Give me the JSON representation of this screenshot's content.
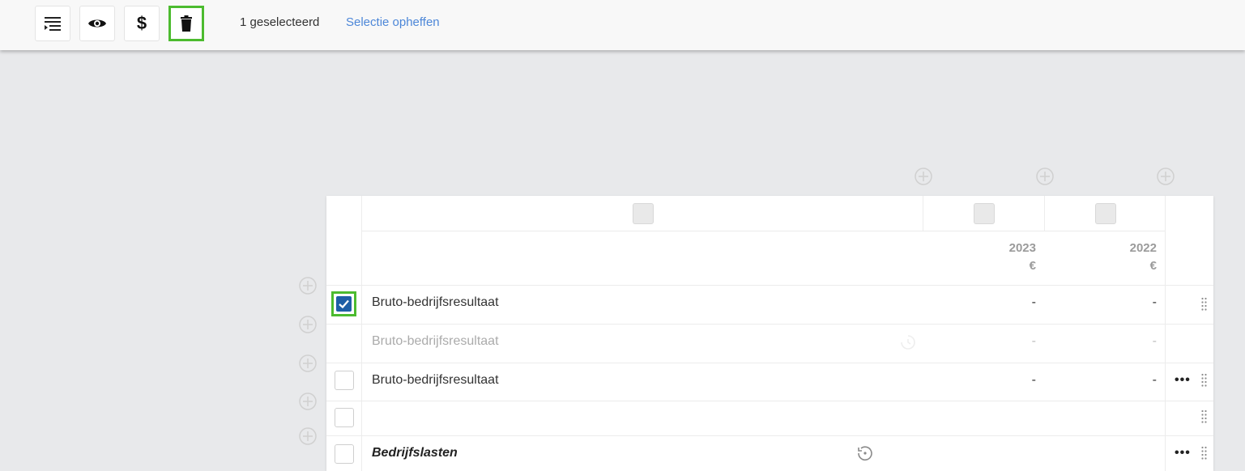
{
  "toolbar": {
    "buttons": [
      {
        "icon": "filter-list-icon"
      },
      {
        "icon": "eye-icon"
      },
      {
        "icon": "dollar-icon",
        "label": "$"
      },
      {
        "icon": "trash-icon",
        "highlighted": true
      }
    ],
    "selection_count": "1 geselecteerd",
    "clear_selection": "Selectie opheffen",
    "highlight_color": "#4cbb2f",
    "link_color": "#4d87d8"
  },
  "table": {
    "columns": [
      {
        "year": "2023",
        "currency": "€"
      },
      {
        "year": "2022",
        "currency": "€"
      }
    ],
    "rows": [
      {
        "label": "Bruto-bedrijfsresultaat",
        "values": [
          "-",
          "-"
        ],
        "checked": true,
        "style": "normal"
      },
      {
        "label": "Bruto-bedrijfsresultaat",
        "values": [
          "-",
          "-"
        ],
        "checked": false,
        "style": "greyed"
      },
      {
        "label": "Bruto-bedrijfsresultaat",
        "values": [
          "-",
          "-"
        ],
        "checked": false,
        "style": "normal"
      },
      {
        "label": "",
        "values": [
          "",
          ""
        ],
        "checked": false,
        "style": "empty"
      },
      {
        "label": "Bedrijfslasten",
        "values": [
          "",
          ""
        ],
        "checked": false,
        "style": "bold-italic"
      }
    ],
    "more_icon": "•••",
    "checkbox_color": "#1f5fa6"
  }
}
